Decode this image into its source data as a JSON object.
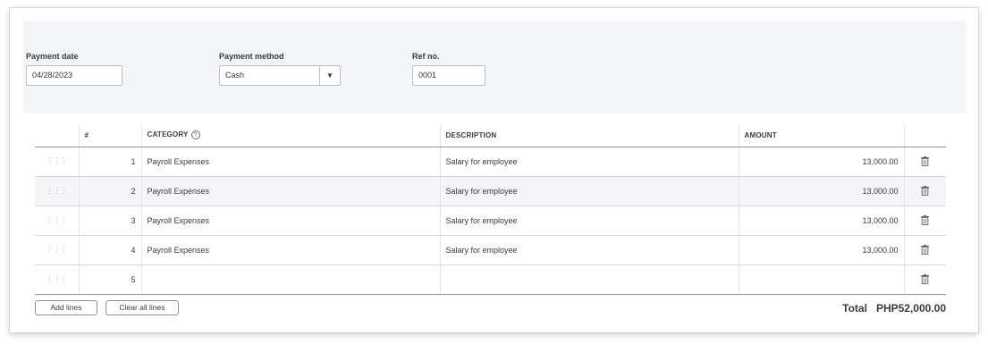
{
  "payment": {
    "date_label": "Payment date",
    "date_value": "04/28/2023",
    "method_label": "Payment method",
    "method_value": "Cash",
    "ref_label": "Ref no.",
    "ref_value": "0001"
  },
  "table": {
    "headers": {
      "number": "#",
      "category": "CATEGORY",
      "description": "DESCRIPTION",
      "amount": "AMOUNT"
    },
    "rows": [
      {
        "num": "1",
        "category": "Payroll Expenses",
        "description": "Salary for employee",
        "amount": "13,000.00"
      },
      {
        "num": "2",
        "category": "Payroll Expenses",
        "description": "Salary for employee",
        "amount": "13,000.00"
      },
      {
        "num": "3",
        "category": "Payroll Expenses",
        "description": "Salary for employee",
        "amount": "13,000.00"
      },
      {
        "num": "4",
        "category": "Payroll Expenses",
        "description": "Salary for employee",
        "amount": "13,000.00"
      },
      {
        "num": "5",
        "category": "",
        "description": "",
        "amount": ""
      }
    ]
  },
  "buttons": {
    "add_lines": "Add lines",
    "clear_all_lines": "Clear all lines"
  },
  "total": {
    "label": "Total",
    "value": "PHP52,000.00"
  }
}
